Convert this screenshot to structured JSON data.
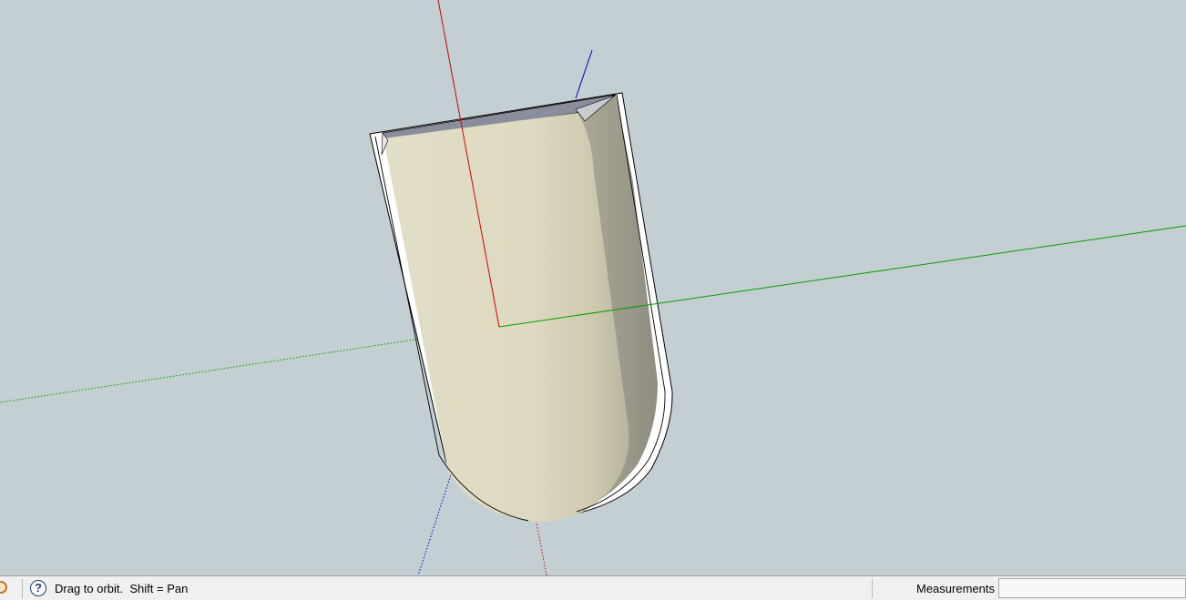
{
  "viewport": {
    "background": "#c3cfd2",
    "axes": {
      "red": "#d40000",
      "green": "#00a000",
      "blue": "#0000c8"
    },
    "model_face_color": "#ded9c0"
  },
  "statusbar": {
    "geo_icon": "geo-location-icon",
    "help_icon": "question-mark-icon",
    "help_glyph": "?",
    "prompt": "Drag to orbit.  Shift = Pan",
    "measurements_label": "Measurements",
    "measurements_value": ""
  }
}
